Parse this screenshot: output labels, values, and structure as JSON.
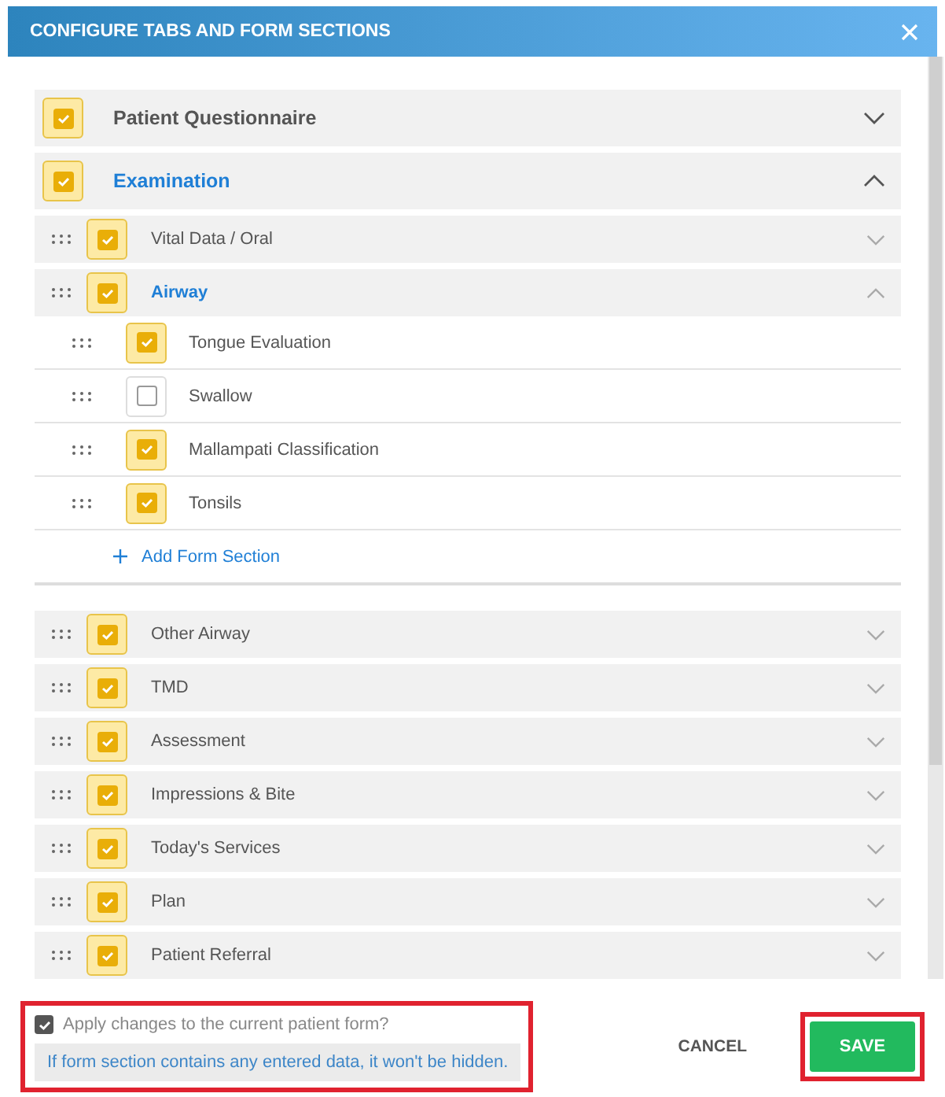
{
  "dialog": {
    "title": "CONFIGURE TABS AND FORM SECTIONS",
    "tabs": [
      {
        "label": "Patient Questionnaire",
        "checked": true,
        "expanded": false
      },
      {
        "label": "Examination",
        "checked": true,
        "expanded": true,
        "sections": [
          {
            "label": "Vital Data / Oral",
            "checked": true,
            "expanded": false
          },
          {
            "label": "Airway",
            "checked": true,
            "expanded": true,
            "children": [
              {
                "label": "Tongue Evaluation",
                "checked": true
              },
              {
                "label": "Swallow",
                "checked": false
              },
              {
                "label": "Mallampati Classification",
                "checked": true
              },
              {
                "label": "Tonsils",
                "checked": true
              }
            ],
            "add_label": "Add Form Section"
          },
          {
            "label": "Other Airway",
            "checked": true,
            "expanded": false
          },
          {
            "label": "TMD",
            "checked": true,
            "expanded": false
          },
          {
            "label": "Assessment",
            "checked": true,
            "expanded": false
          },
          {
            "label": "Impressions & Bite",
            "checked": true,
            "expanded": false
          },
          {
            "label": "Today's Services",
            "checked": true,
            "expanded": false
          },
          {
            "label": "Plan",
            "checked": true,
            "expanded": false
          },
          {
            "label": "Patient Referral",
            "checked": true,
            "expanded": false
          }
        ]
      }
    ]
  },
  "footer": {
    "apply": {
      "label": "Apply changes to the current patient form?",
      "checked": true
    },
    "note": "If form section contains any entered data, it won't be hidden.",
    "cancel": "CANCEL",
    "save": "SAVE"
  }
}
